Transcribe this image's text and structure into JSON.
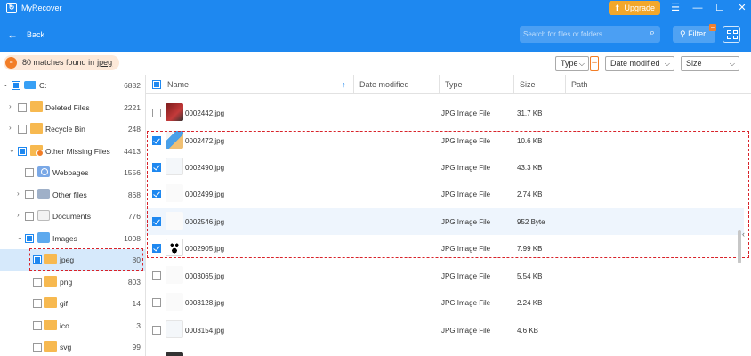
{
  "app": {
    "title": "MyRecover",
    "upgrade_label": "Upgrade",
    "back_label": "Back",
    "search_placeholder": "Search for files or folders",
    "filter_label": "Filter"
  },
  "toolbar": {
    "matches_count": "80",
    "matches_text": "matches found in",
    "matches_location": "jpeg",
    "type_label": "Type",
    "date_label": "Date modified",
    "size_label": "Size"
  },
  "sidebar": {
    "items": [
      {
        "label": "C:",
        "count": "6882"
      },
      {
        "label": "Deleted Files",
        "count": "2221"
      },
      {
        "label": "Recycle Bin",
        "count": "248"
      },
      {
        "label": "Other Missing Files",
        "count": "4413"
      },
      {
        "label": "Webpages",
        "count": "1556"
      },
      {
        "label": "Other files",
        "count": "868"
      },
      {
        "label": "Documents",
        "count": "776"
      },
      {
        "label": "Images",
        "count": "1008"
      },
      {
        "label": "jpeg",
        "count": "80"
      },
      {
        "label": "png",
        "count": "803"
      },
      {
        "label": "gif",
        "count": "14"
      },
      {
        "label": "ico",
        "count": "3"
      },
      {
        "label": "svg",
        "count": "99"
      }
    ]
  },
  "table": {
    "columns": [
      "Name",
      "Date modified",
      "Type",
      "Size",
      "Path"
    ],
    "rows": [
      {
        "name": "0002442.jpg",
        "type": "JPG Image File",
        "size": "31.7 KB",
        "checked": false
      },
      {
        "name": "0002472.jpg",
        "type": "JPG Image File",
        "size": "10.6 KB",
        "checked": true
      },
      {
        "name": "0002490.jpg",
        "type": "JPG Image File",
        "size": "43.3 KB",
        "checked": true
      },
      {
        "name": "0002499.jpg",
        "type": "JPG Image File",
        "size": "2.74 KB",
        "checked": true
      },
      {
        "name": "0002546.jpg",
        "type": "JPG Image File",
        "size": "952 Byte",
        "checked": true
      },
      {
        "name": "0002905.jpg",
        "type": "JPG Image File",
        "size": "7.99 KB",
        "checked": true
      },
      {
        "name": "0003065.jpg",
        "type": "JPG Image File",
        "size": "5.54 KB",
        "checked": false
      },
      {
        "name": "0003128.jpg",
        "type": "JPG Image File",
        "size": "2.24 KB",
        "checked": false
      },
      {
        "name": "0003154.jpg",
        "type": "JPG Image File",
        "size": "4.6 KB",
        "checked": false
      }
    ]
  },
  "colors": {
    "header_bg": "#1e88f0",
    "upgrade_bg": "#f2a72b",
    "accent_orange": "#f27d26",
    "highlight_red": "#d8232a"
  }
}
